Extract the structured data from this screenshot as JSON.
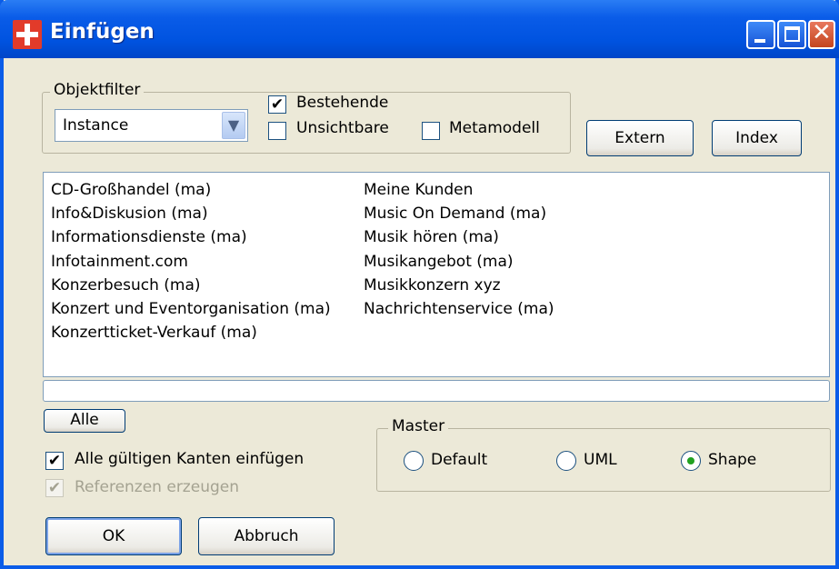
{
  "window": {
    "title": "Einfügen",
    "icon": "app-cross-icon",
    "controls": {
      "minimize": "minimize-icon",
      "maximize": "maximize-icon",
      "close": "close-icon"
    }
  },
  "objektfilter": {
    "legend": "Objektfilter",
    "combo_value": "Instance",
    "bestehende": {
      "label": "Bestehende",
      "checked": true
    },
    "unsichtbare": {
      "label": "Unsichtbare",
      "checked": false
    },
    "metamodell": {
      "label": "Metamodell",
      "checked": false
    }
  },
  "buttons": {
    "extern": "Extern",
    "index": "Index",
    "alle": "Alle",
    "ok": "OK",
    "abbruch": "Abbruch"
  },
  "list": {
    "column1": [
      "CD-Großhandel (ma)",
      "Info&Diskusion (ma)",
      "Informationsdienste (ma)",
      "Infotainment.com",
      "Konzerbesuch (ma)",
      "Konzert und Eventorganisation (ma)",
      "Konzertticket-Verkauf (ma)"
    ],
    "column2": [
      "Meine Kunden",
      "Music On Demand (ma)",
      "Musik hören (ma)",
      "Musikangebot (ma)",
      "Musikkonzern xyz",
      "Nachrichtenservice (ma)"
    ]
  },
  "options": {
    "alle_kanten": {
      "label": "Alle gültigen Kanten einfügen",
      "checked": true
    },
    "referenzen": {
      "label": "Referenzen erzeugen",
      "checked": true,
      "disabled": true
    }
  },
  "master": {
    "legend": "Master",
    "options": [
      "Default",
      "UML",
      "Shape"
    ],
    "selected": "Shape"
  },
  "colors": {
    "titlebar": "#0a5ce8",
    "dialog_bg": "#ece9d8",
    "radio_selected": "#21a121"
  }
}
